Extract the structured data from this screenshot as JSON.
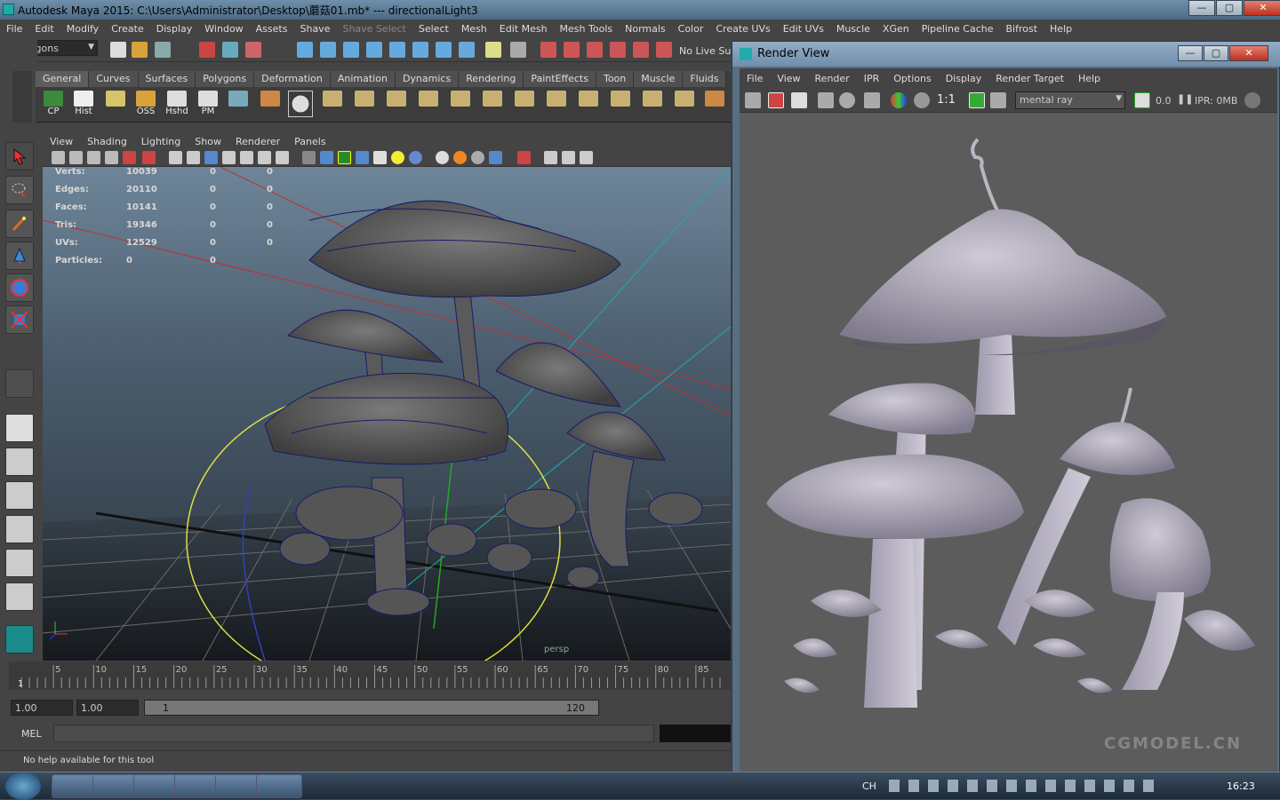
{
  "titlebar": {
    "title": "Autodesk Maya 2015: C:\\Users\\Administrator\\Desktop\\蘑菇01.mb*   ---   directionalLight3",
    "minimize": "—",
    "maximize": "▢",
    "close": "✕"
  },
  "menubar": [
    "File",
    "Edit",
    "Modify",
    "Create",
    "Display",
    "Window",
    "Assets",
    "Shave",
    "Shave Select",
    "Select",
    "Mesh",
    "Edit Mesh",
    "Mesh Tools",
    "Normals",
    "Color",
    "Create UVs",
    "Edit UVs",
    "Muscle",
    "XGen",
    "Pipeline Cache",
    "Bifrost",
    "Help"
  ],
  "statusline": {
    "mode": "Polygons",
    "live_surface": "No Live Surf"
  },
  "shelf": {
    "tabs": [
      "General",
      "Curves",
      "Surfaces",
      "Polygons",
      "Deformation",
      "Animation",
      "Dynamics",
      "Rendering",
      "PaintEffects",
      "Toon",
      "Muscle",
      "Fluids"
    ],
    "active_tab": "General",
    "labels": [
      "CP",
      "Hist",
      "OSS",
      "Hshd",
      "PM"
    ]
  },
  "viewport": {
    "menu": [
      "View",
      "Shading",
      "Lighting",
      "Show",
      "Renderer",
      "Panels"
    ],
    "hud": [
      {
        "label": "Verts:",
        "v1": "10039",
        "v2": "0",
        "v3": "0"
      },
      {
        "label": "Edges:",
        "v1": "20110",
        "v2": "0",
        "v3": "0"
      },
      {
        "label": "Faces:",
        "v1": "10141",
        "v2": "0",
        "v3": "0"
      },
      {
        "label": "Tris:",
        "v1": "19346",
        "v2": "0",
        "v3": "0"
      },
      {
        "label": "UVs:",
        "v1": "12529",
        "v2": "0",
        "v3": "0"
      },
      {
        "label": "Particles:",
        "v1": "0",
        "v2": "0",
        "v3": ""
      }
    ],
    "camera_label": "persp"
  },
  "timeslider": {
    "ticks": [
      "5",
      "10",
      "15",
      "20",
      "25",
      "30",
      "35",
      "40",
      "45",
      "50",
      "55",
      "60",
      "65",
      "70",
      "75",
      "80",
      "85"
    ],
    "current": "1"
  },
  "range": {
    "start": "1.00",
    "playback_start": "1.00",
    "slider_start": "1",
    "slider_end": "120"
  },
  "mel": {
    "label": "MEL"
  },
  "helpline": {
    "text": "No help available for this tool"
  },
  "render_view": {
    "title": "Render View",
    "menu": [
      "File",
      "View",
      "Render",
      "IPR",
      "Options",
      "Display",
      "Render Target",
      "Help"
    ],
    "renderer": "mental ray",
    "ratio": "1:1",
    "value": "0.0",
    "ipr": "IPR: 0MB"
  },
  "watermark": "CGMODEL.CN",
  "taskbar": {
    "clock": "16:23",
    "lang": "CH"
  },
  "colors": {
    "accent": "#3a6a9a",
    "wire": "#1a1a6a",
    "viewport_top": "#6e8599"
  }
}
